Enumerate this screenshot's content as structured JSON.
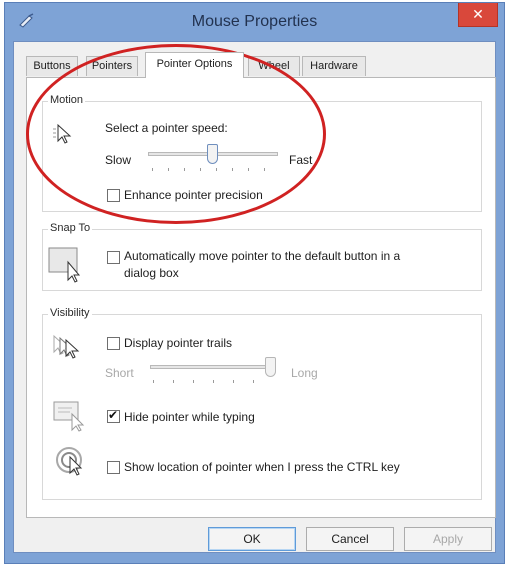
{
  "window": {
    "title": "Mouse Properties",
    "close_icon": "close-icon",
    "app_icon": "mouse-app-icon"
  },
  "tabs": [
    {
      "label": "Buttons",
      "active": false
    },
    {
      "label": "Pointers",
      "active": false
    },
    {
      "label": "Pointer Options",
      "active": true
    },
    {
      "label": "Wheel",
      "active": false
    },
    {
      "label": "Hardware",
      "active": false
    }
  ],
  "motion": {
    "group_label": "Motion",
    "icon": "pointer-speed-icon",
    "speed_label": "Select a pointer speed:",
    "slow_label": "Slow",
    "fast_label": "Fast",
    "speed_value": 0.5,
    "enhance_label": "Enhance pointer precision",
    "enhance_checked": false
  },
  "snap_to": {
    "group_label": "Snap To",
    "icon": "snap-to-button-icon",
    "auto_move_label": "Automatically move pointer to the default button in a",
    "auto_move_label_2": "dialog box",
    "auto_move_checked": false
  },
  "visibility": {
    "group_label": "Visibility",
    "trails_icon": "pointer-trails-icon",
    "trails_label": "Display pointer trails",
    "trails_checked": false,
    "short_label": "Short",
    "long_label": "Long",
    "trails_value": 1.0,
    "hide_icon": "hide-pointer-icon",
    "hide_label": "Hide pointer while typing",
    "hide_checked": true,
    "show_location_icon": "pointer-location-icon",
    "show_location_label": "Show location of pointer when I press the CTRL key",
    "show_location_checked": false
  },
  "buttons": {
    "ok": "OK",
    "cancel": "Cancel",
    "apply": "Apply"
  },
  "colors": {
    "title_bar": "#7ea3d6",
    "close_button": "#d9483b",
    "annotation": "#d02222"
  }
}
